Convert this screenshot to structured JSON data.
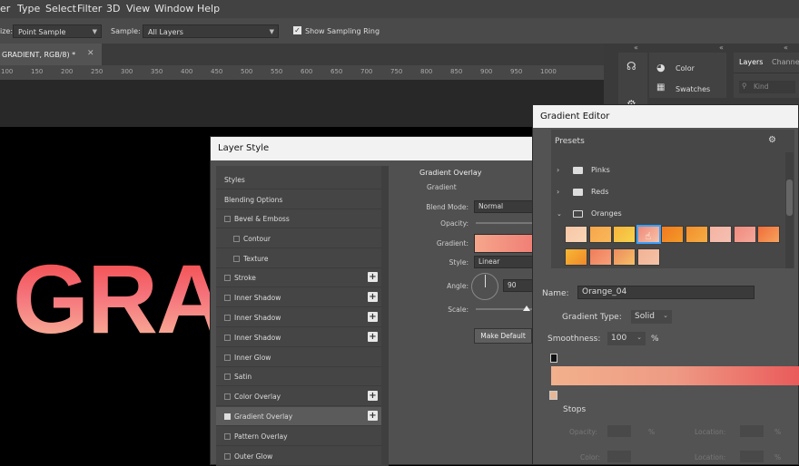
{
  "menubar": {
    "items": [
      "er",
      "Type",
      "Select",
      "Filter",
      "3D",
      "View",
      "Window",
      "Help"
    ]
  },
  "options": {
    "size_label": "ize:",
    "sample_size_value": "Point Sample",
    "sample_label": "Sample:",
    "sample_value": "All Layers",
    "show_ring_label": "Show Sampling Ring",
    "show_ring_checked": true
  },
  "document": {
    "tab_label": "GRADIENT, RGB/8) *",
    "canvas_text": "GRA"
  },
  "ruler": {
    "ticks": [
      "100",
      "150",
      "200",
      "250",
      "300",
      "350",
      "400",
      "450",
      "500",
      "550",
      "600",
      "650",
      "700",
      "750",
      "800",
      "850",
      "900",
      "950",
      "1000"
    ]
  },
  "right_panel": {
    "color_label": "Color",
    "swatches_label": "Swatches",
    "tab_layers": "Layers",
    "tab_channels": "Channe",
    "search_placeholder": "Kind"
  },
  "layer_style": {
    "title": "Layer Style",
    "styles_header": "Styles",
    "blending_options": "Blending Options",
    "items": [
      {
        "label": "Bevel & Emboss",
        "checked": false,
        "plus": false,
        "indent": false
      },
      {
        "label": "Contour",
        "checked": false,
        "plus": false,
        "indent": true
      },
      {
        "label": "Texture",
        "checked": false,
        "plus": false,
        "indent": true
      },
      {
        "label": "Stroke",
        "checked": false,
        "plus": true,
        "indent": false
      },
      {
        "label": "Inner Shadow",
        "checked": false,
        "plus": true,
        "indent": false
      },
      {
        "label": "Inner Shadow",
        "checked": false,
        "plus": true,
        "indent": false
      },
      {
        "label": "Inner Shadow",
        "checked": false,
        "plus": true,
        "indent": false
      },
      {
        "label": "Inner Glow",
        "checked": false,
        "plus": false,
        "indent": false
      },
      {
        "label": "Satin",
        "checked": false,
        "plus": false,
        "indent": false
      },
      {
        "label": "Color Overlay",
        "checked": false,
        "plus": true,
        "indent": false
      },
      {
        "label": "Gradient Overlay",
        "checked": true,
        "plus": true,
        "indent": false
      },
      {
        "label": "Pattern Overlay",
        "checked": false,
        "plus": false,
        "indent": false
      },
      {
        "label": "Outer Glow",
        "checked": false,
        "plus": false,
        "indent": false
      }
    ],
    "section_title": "Gradient Overlay",
    "subsection": "Gradient",
    "blend_mode_label": "Blend Mode:",
    "blend_mode_value": "Normal",
    "opacity_label": "Opacity:",
    "gradient_label": "Gradient:",
    "style_label": "Style:",
    "style_value": "Linear",
    "angle_label": "Angle:",
    "angle_value": "90",
    "scale_label": "Scale:",
    "make_default": "Make Default"
  },
  "gradient_editor": {
    "title": "Gradient Editor",
    "presets_label": "Presets",
    "gear_glyph": "⚙",
    "folders": [
      "Pinks",
      "Reds",
      "Oranges"
    ],
    "name_label": "Name:",
    "name_value": "Orange_04",
    "gradient_type_label": "Gradient Type:",
    "gradient_type_value": "Solid",
    "smoothness_label": "Smoothness:",
    "smoothness_value": "100",
    "smoothness_unit": "%",
    "stops_label": "Stops",
    "opacity_label": "Opacity:",
    "location_label": "Location:",
    "color_label": "Color:",
    "percent": "%",
    "gradient_bar_colors": [
      "#f2b08c",
      "#ee9a84",
      "#ea5a5a"
    ]
  },
  "swatches": [
    [
      "#f9c6a6",
      "#f8d6b6"
    ],
    [
      "#f7a64b",
      "#f9b85a"
    ],
    [
      "#f7b43c",
      "#f6d34c"
    ],
    [
      "#ef8a7a",
      "#f8c3a8"
    ],
    [
      "#f07a1e",
      "#f39a2a"
    ],
    [
      "#f28f2d",
      "#f6ad43"
    ],
    [
      "#f6b3a2",
      "#f4c0b2"
    ],
    [
      "#f08a7e",
      "#f5a89a"
    ],
    [
      "#f06e3a",
      "#f7a35d"
    ],
    [
      "#f7b834",
      "#f0882a"
    ],
    [
      "#f07d5a",
      "#f6a079"
    ],
    [
      "#ec8c5f",
      "#f6bf66"
    ],
    [
      "#f2b295",
      "#f6c2a6"
    ]
  ]
}
